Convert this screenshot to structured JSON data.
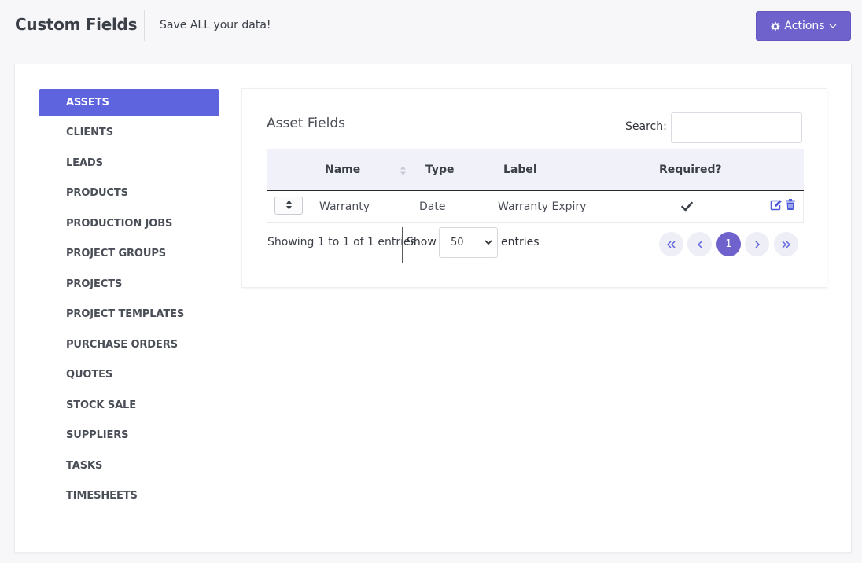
{
  "header": {
    "title": "Custom Fields",
    "subtitle": "Save ALL your data!",
    "actions_label": "Actions"
  },
  "sidebar": {
    "items": [
      {
        "label": "ASSETS",
        "active": true
      },
      {
        "label": "CLIENTS",
        "active": false
      },
      {
        "label": "LEADS",
        "active": false
      },
      {
        "label": "PRODUCTS",
        "active": false
      },
      {
        "label": "PRODUCTION JOBS",
        "active": false
      },
      {
        "label": "PROJECT GROUPS",
        "active": false
      },
      {
        "label": "PROJECTS",
        "active": false
      },
      {
        "label": "PROJECT TEMPLATES",
        "active": false
      },
      {
        "label": "PURCHASE ORDERS",
        "active": false
      },
      {
        "label": "QUOTES",
        "active": false
      },
      {
        "label": "STOCK SALE",
        "active": false
      },
      {
        "label": "SUPPLIERS",
        "active": false
      },
      {
        "label": "TASKS",
        "active": false
      },
      {
        "label": "TIMESHEETS",
        "active": false
      }
    ]
  },
  "panel": {
    "title": "Asset Fields",
    "search_label": "Search:",
    "search_value": ""
  },
  "table": {
    "columns": [
      "Name",
      "Type",
      "Label",
      "Required?"
    ],
    "rows": [
      {
        "name": "Warranty",
        "type": "Date",
        "label": "Warranty Expiry",
        "required": true
      }
    ]
  },
  "footer": {
    "showing": "Showing 1 to 1 of 1 entries",
    "show_label": "Show",
    "page_length": "50",
    "entries_label": "entries",
    "current_page": "1"
  },
  "colors": {
    "accent": "#6f62cc",
    "sidebar_active": "#5e64dd",
    "icon_blue": "#4a5ad8"
  },
  "icons": {
    "actions": "gear-icon",
    "actions_caret": "chevron-down-icon",
    "sort": "sort-icon",
    "drag": "drag-handle-icon",
    "required": "check-icon",
    "edit": "edit-icon",
    "delete": "trash-icon",
    "first": "double-chevron-left-icon",
    "prev": "chevron-left-icon",
    "next": "chevron-right-icon",
    "last": "double-chevron-right-icon"
  }
}
